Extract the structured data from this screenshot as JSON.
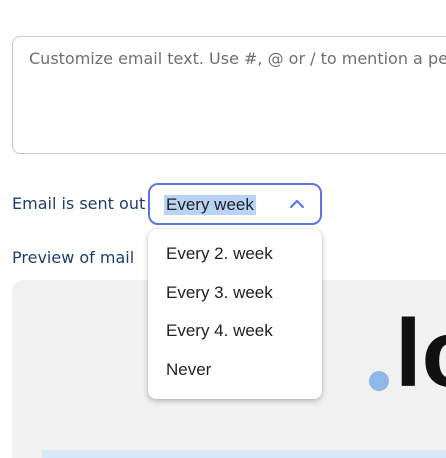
{
  "email_text": {
    "placeholder": "Customize email text. Use #, @ or / to mention a perso"
  },
  "frequency": {
    "label": "Email is sent out",
    "selected": "Every week",
    "options": [
      "Every 2. week",
      "Every 3. week",
      "Every 4. week",
      "Never"
    ]
  },
  "preview": {
    "label": "Preview of mail",
    "logo_text": "lo"
  },
  "colors": {
    "accent": "#5b76e4",
    "label_text": "#1f3f6b",
    "selection_highlight": "#b8d3f4",
    "preview_bg": "#f1f1f1",
    "logo_dot": "#8fb8e8"
  },
  "icons": {
    "select_chevron": "chevron-up-icon"
  }
}
